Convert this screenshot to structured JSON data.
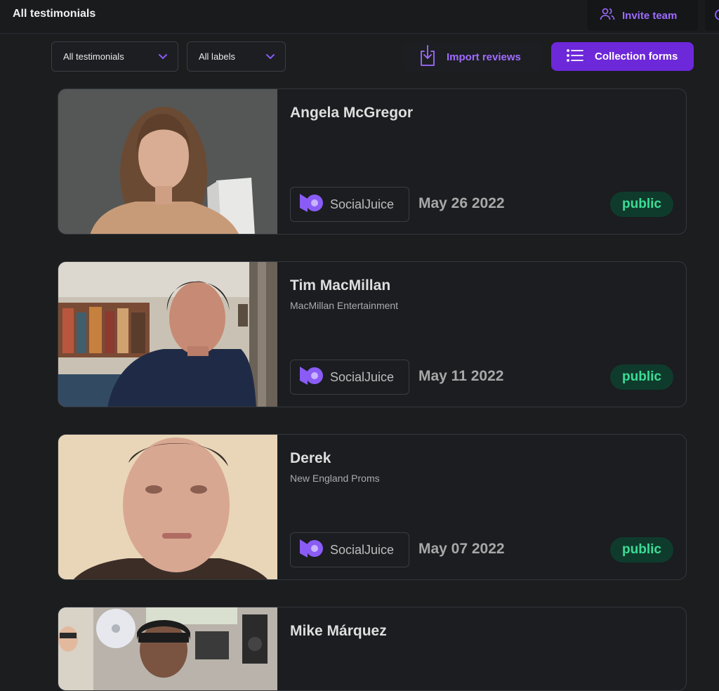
{
  "header": {
    "title": "All testimonials",
    "invite_label": "Invite team"
  },
  "toolbar": {
    "filter_testimonials": "All testimonials",
    "filter_labels": "All labels",
    "import_label": "Import reviews",
    "collection_label": "Collection forms"
  },
  "colors": {
    "accent": "#6d28d9",
    "accent_text": "#a06cff",
    "badge_bg": "#0f3b2c",
    "badge_text": "#3ddc97",
    "background": "#1b1d1f"
  },
  "testimonials": [
    {
      "name": "Angela McGregor",
      "company": "",
      "source": "SocialJuice",
      "date": "May 26 2022",
      "status": "public"
    },
    {
      "name": "Tim MacMillan",
      "company": "MacMillan Entertainment",
      "source": "SocialJuice",
      "date": "May 11 2022",
      "status": "public"
    },
    {
      "name": "Derek",
      "company": "New England Proms",
      "source": "SocialJuice",
      "date": "May 07 2022",
      "status": "public"
    },
    {
      "name": "Mike Márquez",
      "company": "",
      "source": "",
      "date": "",
      "status": ""
    }
  ]
}
